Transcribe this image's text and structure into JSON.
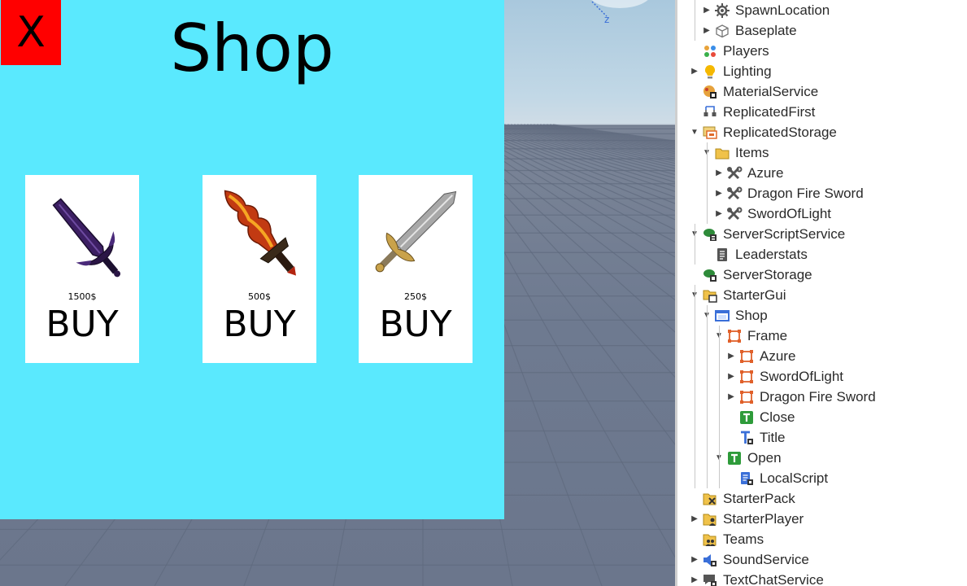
{
  "viewport": {
    "axis_label": "z"
  },
  "shop": {
    "title": "Shop",
    "close_label": "X",
    "items": [
      {
        "name": "Azure",
        "price": "1500$",
        "buy_label": "BUY",
        "icon": "purple-sword-icon"
      },
      {
        "name": "Dragon Fire Sword",
        "price": "500$",
        "buy_label": "BUY",
        "icon": "fire-sword-icon"
      },
      {
        "name": "SwordOfLight",
        "price": "250$",
        "buy_label": "BUY",
        "icon": "silver-sword-icon"
      }
    ]
  },
  "explorer": {
    "items": [
      {
        "label": "SpawnLocation",
        "depth": 1,
        "arrow": "right",
        "icon": "spawn-location-icon"
      },
      {
        "label": "Baseplate",
        "depth": 1,
        "arrow": "right",
        "icon": "part-icon"
      },
      {
        "label": "Players",
        "depth": 0,
        "arrow": "none",
        "icon": "players-icon"
      },
      {
        "label": "Lighting",
        "depth": 0,
        "arrow": "right",
        "icon": "lighting-icon"
      },
      {
        "label": "MaterialService",
        "depth": 0,
        "arrow": "none",
        "icon": "material-service-icon"
      },
      {
        "label": "ReplicatedFirst",
        "depth": 0,
        "arrow": "none",
        "icon": "replicated-first-icon"
      },
      {
        "label": "ReplicatedStorage",
        "depth": 0,
        "arrow": "down",
        "icon": "replicated-storage-icon"
      },
      {
        "label": "Items",
        "depth": 1,
        "arrow": "down",
        "icon": "folder-icon"
      },
      {
        "label": "Azure",
        "depth": 2,
        "arrow": "right",
        "icon": "tool-icon"
      },
      {
        "label": "Dragon Fire Sword",
        "depth": 2,
        "arrow": "right",
        "icon": "tool-icon"
      },
      {
        "label": "SwordOfLight",
        "depth": 2,
        "arrow": "right",
        "icon": "tool-icon"
      },
      {
        "label": "ServerScriptService",
        "depth": 0,
        "arrow": "down",
        "icon": "server-script-service-icon"
      },
      {
        "label": "Leaderstats",
        "depth": 1,
        "arrow": "none",
        "icon": "script-icon"
      },
      {
        "label": "ServerStorage",
        "depth": 0,
        "arrow": "none",
        "icon": "server-storage-icon"
      },
      {
        "label": "StarterGui",
        "depth": 0,
        "arrow": "down",
        "icon": "starter-gui-icon"
      },
      {
        "label": "Shop",
        "depth": 1,
        "arrow": "down",
        "icon": "screen-gui-icon"
      },
      {
        "label": "Frame",
        "depth": 2,
        "arrow": "down",
        "icon": "frame-icon"
      },
      {
        "label": "Azure",
        "depth": 3,
        "arrow": "right",
        "icon": "frame-icon"
      },
      {
        "label": "SwordOfLight",
        "depth": 3,
        "arrow": "right",
        "icon": "frame-icon"
      },
      {
        "label": "Dragon Fire Sword",
        "depth": 3,
        "arrow": "right",
        "icon": "frame-icon"
      },
      {
        "label": "Close",
        "depth": 3,
        "arrow": "none",
        "icon": "text-button-icon"
      },
      {
        "label": "Title",
        "depth": 3,
        "arrow": "none",
        "icon": "text-label-icon"
      },
      {
        "label": "Open",
        "depth": 2,
        "arrow": "down",
        "icon": "text-button-icon"
      },
      {
        "label": "LocalScript",
        "depth": 3,
        "arrow": "none",
        "icon": "local-script-icon"
      },
      {
        "label": "StarterPack",
        "depth": 0,
        "arrow": "none",
        "icon": "starter-pack-icon"
      },
      {
        "label": "StarterPlayer",
        "depth": 0,
        "arrow": "right",
        "icon": "starter-player-icon"
      },
      {
        "label": "Teams",
        "depth": 0,
        "arrow": "none",
        "icon": "teams-icon"
      },
      {
        "label": "SoundService",
        "depth": 0,
        "arrow": "right",
        "icon": "sound-service-icon"
      },
      {
        "label": "TextChatService",
        "depth": 0,
        "arrow": "right",
        "icon": "text-chat-service-icon"
      }
    ]
  }
}
